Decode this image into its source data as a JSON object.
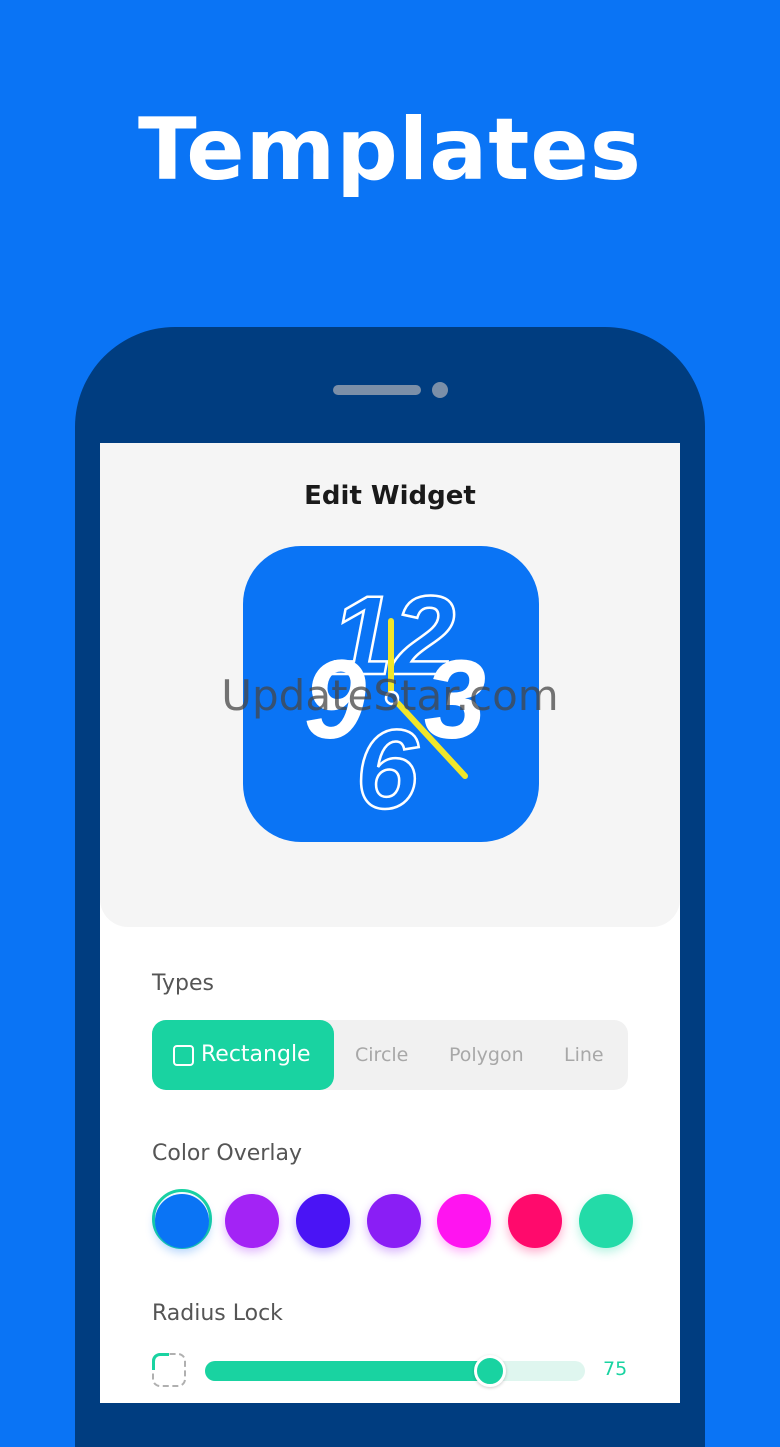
{
  "hero": {
    "title": "Templates"
  },
  "screen": {
    "title": "Edit Widget",
    "watermark": "UpdateStar.com",
    "widget": {
      "numerals": [
        "12",
        "9",
        "3",
        "6"
      ],
      "hand_color": "#f0e62a",
      "background": "#0a74f5"
    }
  },
  "types": {
    "label": "Types",
    "options": [
      "Rectangle",
      "Circle",
      "Polygon",
      "Line"
    ],
    "selected": "Rectangle"
  },
  "color_overlay": {
    "label": "Color Overlay",
    "swatches": [
      "#0a74f5",
      "#a323f5",
      "#4a14f5",
      "#8a1ef5",
      "#ff14f0",
      "#ff0a6c",
      "#23dba8"
    ],
    "selected_index": 0
  },
  "radius_lock": {
    "label": "Radius Lock",
    "value": "75",
    "fraction": 0.75
  },
  "colors": {
    "accent": "#19d3a1",
    "brand": "#0a74f5",
    "phone": "#003d80"
  }
}
